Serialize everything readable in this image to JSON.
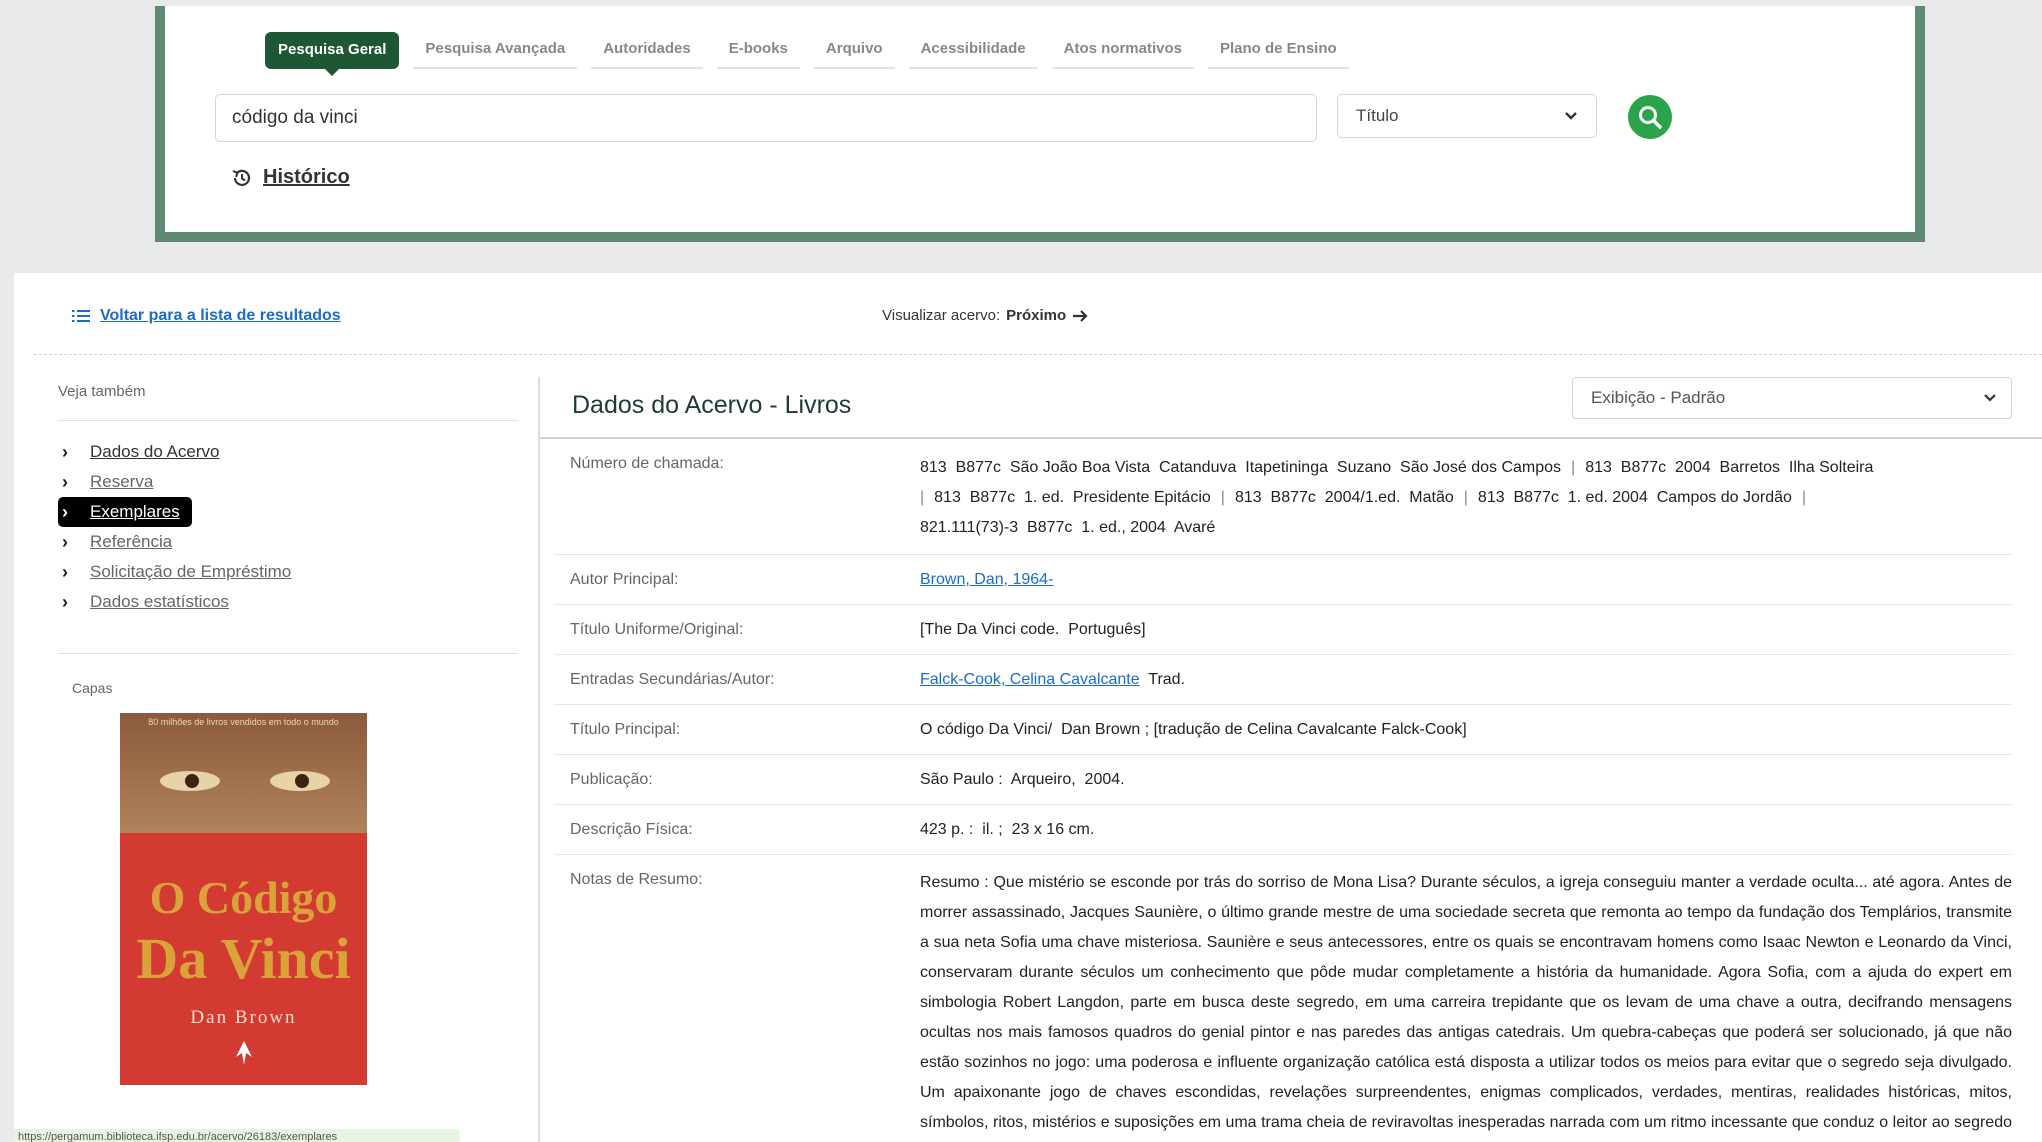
{
  "search": {
    "tabs": [
      "Pesquisa Geral",
      "Pesquisa Avançada",
      "Autoridades",
      "E-books",
      "Arquivo",
      "Acessibilidade",
      "Atos normativos",
      "Plano de Ensino"
    ],
    "query": "código da vinci",
    "field": "Título",
    "history_label": "Histórico"
  },
  "nav": {
    "back_label": "Voltar para a lista de resultados",
    "view_label": "Visualizar acervo:",
    "next_label": "Próximo"
  },
  "sidebar": {
    "heading": "Veja também",
    "items": [
      "Dados do Acervo",
      "Reserva",
      "Exemplares",
      "Referência",
      "Solicitação de Empréstimo",
      "Dados estatísticos"
    ],
    "active_item": "Exemplares",
    "covers_label": "Capas"
  },
  "cover": {
    "tagline": "80 milhões de livros vendidos em todo o mundo",
    "title_line1": "O Código",
    "title_line2": "Da Vinci",
    "author": "Dan Brown"
  },
  "status_url": "https://pergamum.biblioteca.ifsp.edu.br/acervo/26183/exemplares",
  "details": {
    "title": "Dados do Acervo - Livros",
    "view_mode": "Exibição - Padrão",
    "rows": [
      {
        "label": "Número de chamada:",
        "calls": [
          "813  B877c  São João Boa Vista  Catanduva  Itapetininga  Suzano  São José dos Campos",
          "813  B877c  2004  Barretos  Ilha Solteira",
          "813  B877c  1. ed.  Presidente Epitácio",
          "813  B877c  2004/1.ed.  Matão",
          "813  B877c  1. ed. 2004  Campos do Jordão",
          "821.111(73)-3  B877c  1. ed., 2004  Avaré"
        ]
      },
      {
        "label": "Autor Principal:",
        "value": "Brown, Dan, 1964-"
      },
      {
        "label": "Título Uniforme/Original:",
        "value": "[The Da Vinci code.  Português]"
      },
      {
        "label": "Entradas Secundárias/Autor:",
        "value": "Falck-Cook, Celina Cavalcante",
        "suffix": "Trad."
      },
      {
        "label": "Título Principal:",
        "value": "O código Da Vinci/  Dan Brown ; [tradução de Celina Cavalcante Falck-Cook]"
      },
      {
        "label": "Publicação:",
        "value": "São Paulo :  Arqueiro,  2004."
      },
      {
        "label": "Descrição Física:",
        "value": "423 p. :  il. ;  23 x 16 cm."
      },
      {
        "label": "Notas de Resumo:",
        "value": "Resumo : Que mistério se esconde por trás do sorriso de Mona Lisa? Durante séculos, a igreja conseguiu manter a verdade oculta... até agora. Antes de morrer assassinado, Jacques Saunière, o último grande mestre de uma sociedade secreta que remonta ao tempo da fundação dos Templários, transmite a sua neta Sofia uma chave misteriosa. Saunière e seus antecessores, entre os quais se encontravam homens como Isaac Newton e Leonardo da Vinci, conservaram durante séculos um conhecimento que pôde mudar completamente a história da humanidade. Agora Sofia, com a ajuda do expert em simbologia Robert Langdon, parte em busca deste segredo, em uma carreira trepidante que os levam de uma chave a outra, decifrando mensagens ocultas nos mais famosos quadros do genial pintor e nas paredes das antigas catedrais. Um quebra-cabeças que poderá ser solucionado, já que não estão sozinhos no jogo: uma poderosa e influente organização católica está disposta a utilizar todos os meios para evitar que o segredo seja divulgado. Um apaixonante jogo de chaves escondidas, revelações surpreendentes, enigmas complicados, verdades, mentiras, realidades históricas, mitos, símbolos, ritos, mistérios e suposições em uma trama cheia de reviravoltas inesperadas narrada com um ritmo incessante que conduz o leitor ao segredo mais cuidadosamente guardado desde o inicio da nossa era."
      }
    ]
  },
  "colors": {
    "brand_green": "#1d5733",
    "frame_green": "#5e8a72",
    "search_button": "#2aa34b",
    "link_blue": "#1a6cc7"
  }
}
